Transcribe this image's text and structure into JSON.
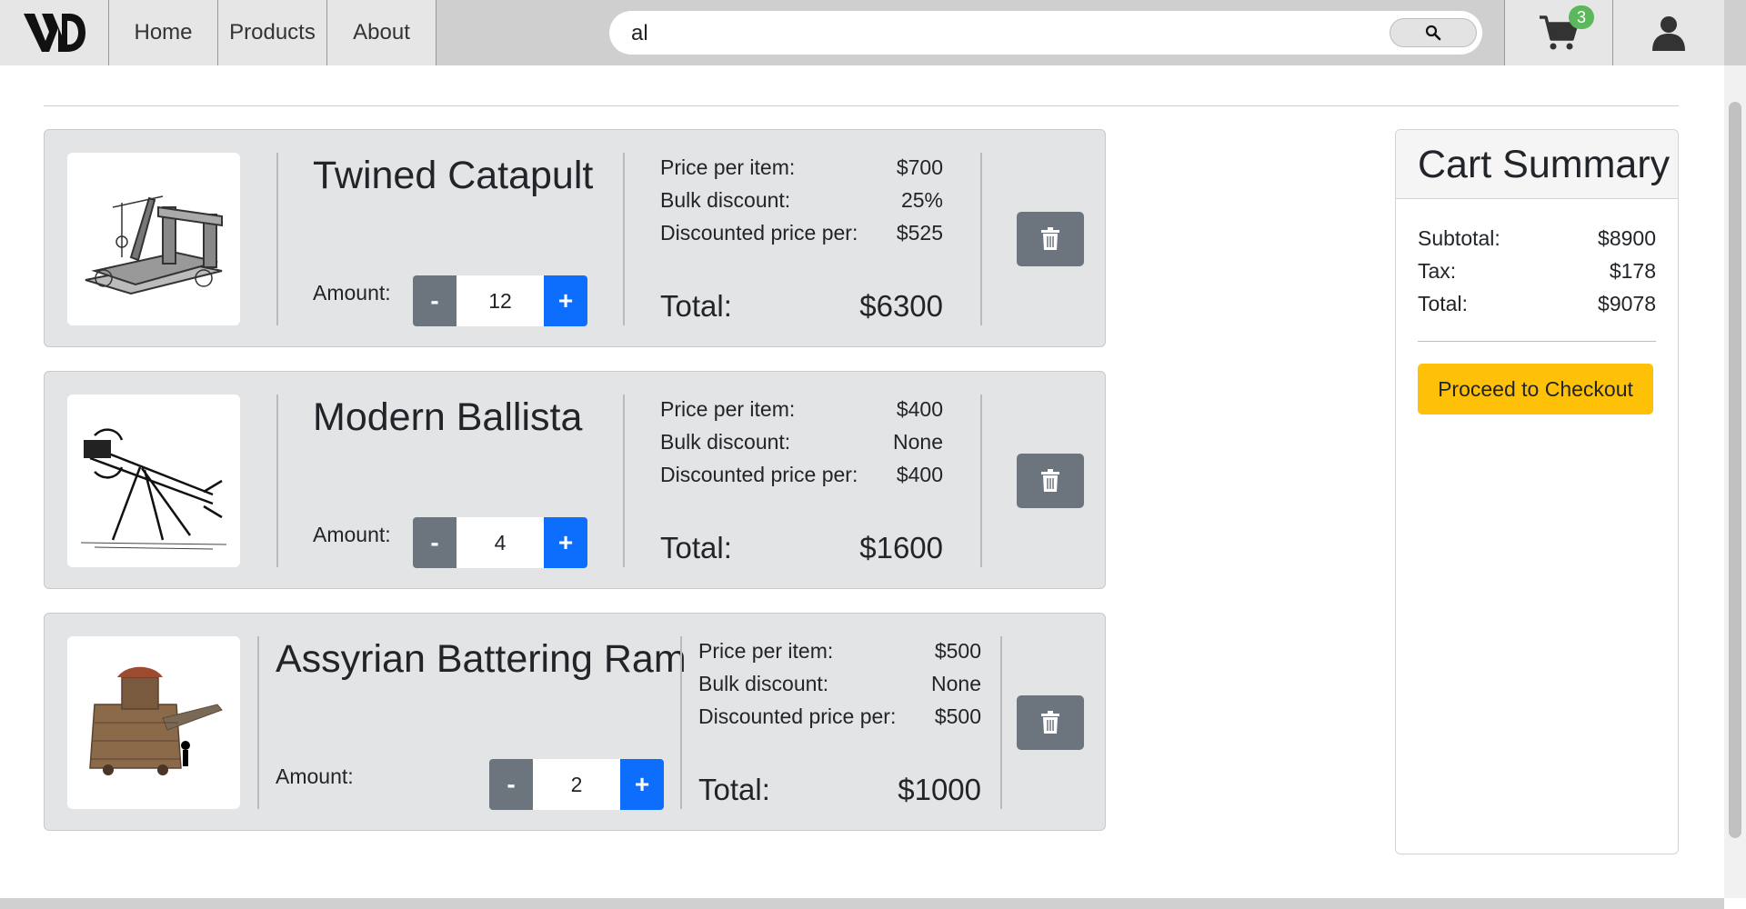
{
  "nav": {
    "logo": "VD",
    "links": [
      "Home",
      "Products",
      "About"
    ],
    "search_value": "al",
    "cart_count": "3"
  },
  "items": [
    {
      "name": "Twined Catapult",
      "amount_label": "Amount:",
      "quantity": "12",
      "minus": "-",
      "plus": "+",
      "price_label": "Price per item:",
      "price": "$700",
      "discount_label": "Bulk discount:",
      "discount": "25%",
      "discounted_label": "Discounted price per:",
      "discounted": "$525",
      "total_label": "Total:",
      "total": "$6300"
    },
    {
      "name": "Modern Ballista",
      "amount_label": "Amount:",
      "quantity": "4",
      "minus": "-",
      "plus": "+",
      "price_label": "Price per item:",
      "price": "$400",
      "discount_label": "Bulk discount:",
      "discount": "None",
      "discounted_label": "Discounted price per:",
      "discounted": "$400",
      "total_label": "Total:",
      "total": "$1600"
    },
    {
      "name": "Assyrian Battering Ram",
      "amount_label": "Amount:",
      "quantity": "2",
      "minus": "-",
      "plus": "+",
      "price_label": "Price per item:",
      "price": "$500",
      "discount_label": "Bulk discount:",
      "discount": "None",
      "discounted_label": "Discounted price per:",
      "discounted": "$500",
      "total_label": "Total:",
      "total": "$1000"
    }
  ],
  "summary": {
    "title": "Cart Summary",
    "subtotal_label": "Subtotal:",
    "subtotal": "$8900",
    "tax_label": "Tax:",
    "tax": "$178",
    "total_label": "Total:",
    "total": "$9078",
    "checkout": "Proceed to Checkout"
  },
  "colors": {
    "primary": "#0d6efd",
    "secondary": "#6c757d",
    "warning": "#ffc107",
    "badge": "#5cb85c"
  },
  "icons": [
    "search-icon",
    "cart-icon",
    "user-icon",
    "trash-icon"
  ]
}
